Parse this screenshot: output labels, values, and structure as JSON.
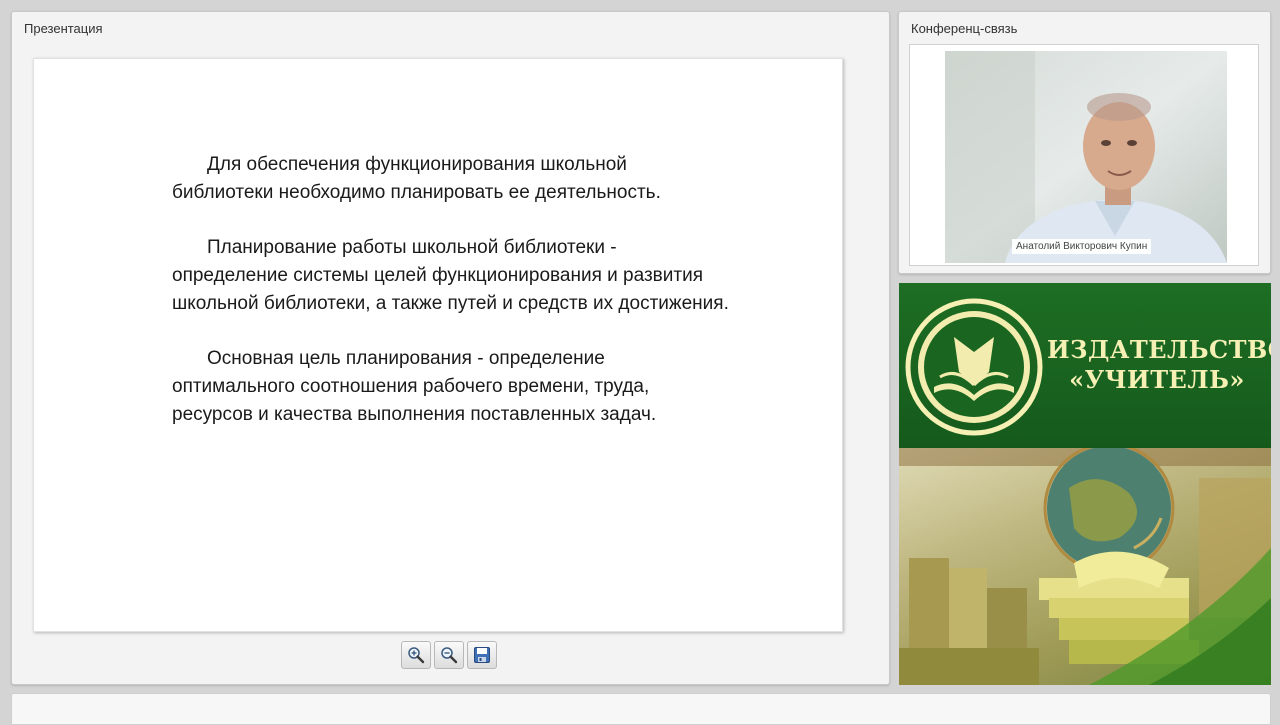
{
  "presentation": {
    "title": "Презентация",
    "slide": {
      "paragraphs": [
        "Для обеспечения функционирования школьной библиотеки необходимо планировать ее деятельность.",
        "Планирование работы школьной библиотеки - определение системы целей функционирования и развития школьной библиотеки, а также путей и средств их достижения.",
        "Основная цель планирования - определение оптимального соотношения рабочего времени, труда, ресурсов и качества выполнения поставленных задач."
      ]
    },
    "toolbar": [
      {
        "name": "zoom-in",
        "icon": "zoom-in-icon"
      },
      {
        "name": "zoom-out",
        "icon": "zoom-out-icon"
      },
      {
        "name": "save",
        "icon": "save-icon"
      }
    ]
  },
  "conference": {
    "title": "Конференц-связь",
    "speaker_name": "Анатолий Викторович Купин"
  },
  "banner": {
    "line1": "ИЗДАТЕЛЬСТВО",
    "line2": "«УЧИТЕЛЬ»",
    "colors": {
      "green": "#1a6621",
      "cream": "#f6f0b5"
    }
  }
}
